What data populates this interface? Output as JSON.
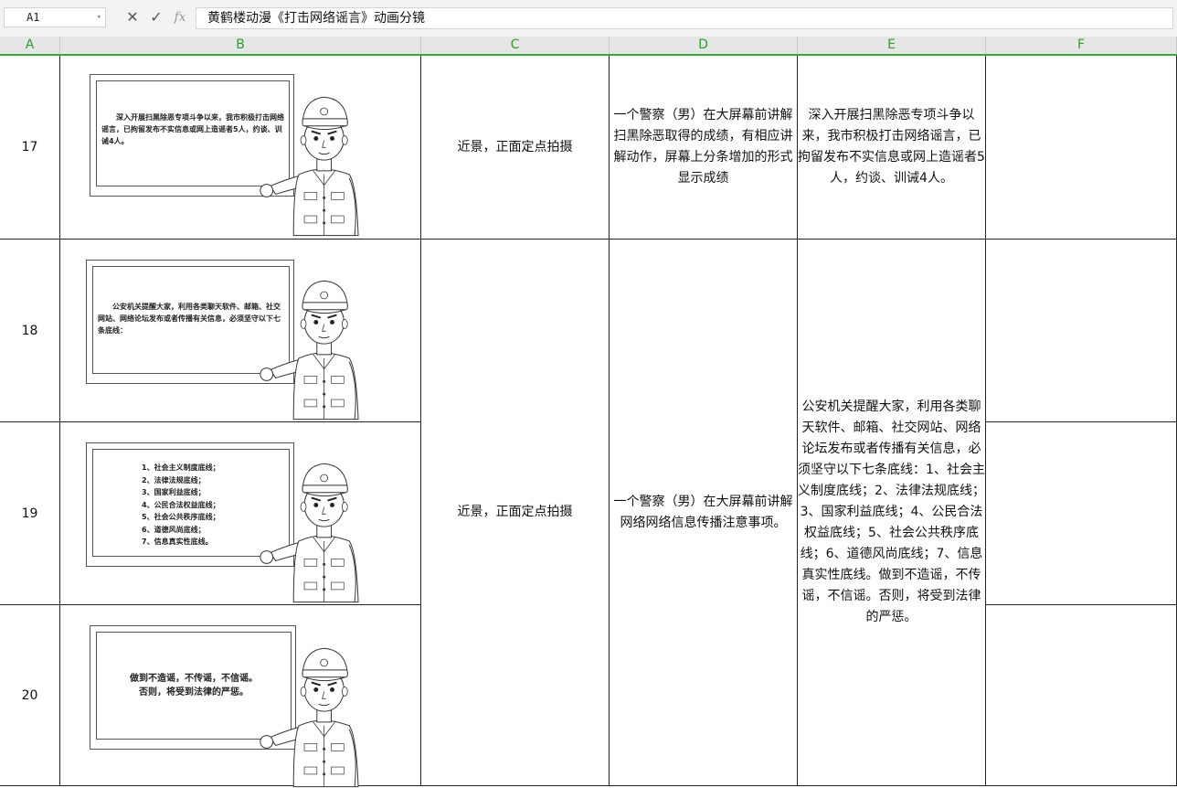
{
  "formula_bar": {
    "name_box": "A1",
    "cancel_icon": "close-icon",
    "confirm_icon": "check-icon",
    "fx_label": "fx",
    "value": "黄鹤楼动漫《打击网络谣言》动画分镜"
  },
  "columns": [
    "A",
    "B",
    "C",
    "D",
    "E",
    "F"
  ],
  "rows": [
    {
      "num": "17"
    },
    {
      "num": "18"
    },
    {
      "num": "19"
    },
    {
      "num": "20"
    }
  ],
  "cells": {
    "c17": "近景，正面定点拍摄",
    "d17": "一个警察（男）在大屏幕前讲解扫黑除恶取得的成绩，有相应讲解动作，屏幕上分条增加的形式显示成绩",
    "e17": "深入开展扫黑除恶专项斗争以来，我市积极打击网络谣言，已拘留发布不实信息或网上造谣者5人，约谈、训诫4人。",
    "c18_20": "近景，正面定点拍摄",
    "d18_20": "一个警察（男）在大屏幕前讲解网络网络信息传播注意事项。",
    "e18_20": "公安机关提醒大家，利用各类聊天软件、邮箱、社交网站、网络论坛发布或者传播有关信息，必须坚守以下七条底线：1、社会主义制度底线；2、法律法规底线；3、国家利益底线；4、公民合法权益底线；5、社会公共秩序底线；6、道德风尚底线；7、信息真实性底线。做到不造谣，不传谣，不信谣。否则，将受到法律的严惩。"
  },
  "boards": {
    "b17": "深入开展扫黑除恶专项斗争以来，我市积极打击网络谣言，已拘留发布不实信息或网上造谣者5人，约谈、训诫4人。",
    "b18": "公安机关提醒大家，利用各类聊天软件、邮箱、社交网站、网络论坛发布或者传播有关信息，必须坚守以下七条底线：",
    "b19": [
      "1、社会主义制度底线；",
      "2、法律法规底线；",
      "3、国家利益底线；",
      "4、公民合法权益底线；",
      "5、社会公共秩序底线；",
      "6、道德风尚底线；",
      "7、信息真实性底线。"
    ],
    "b20_line1": "做到不造谣，不传谣，不信谣。",
    "b20_line2": "否则，将受到法律的严惩。"
  },
  "colors": {
    "header_text": "#2e9a2e",
    "header_accent": "#3aa53a",
    "grid_line": "#222222"
  }
}
